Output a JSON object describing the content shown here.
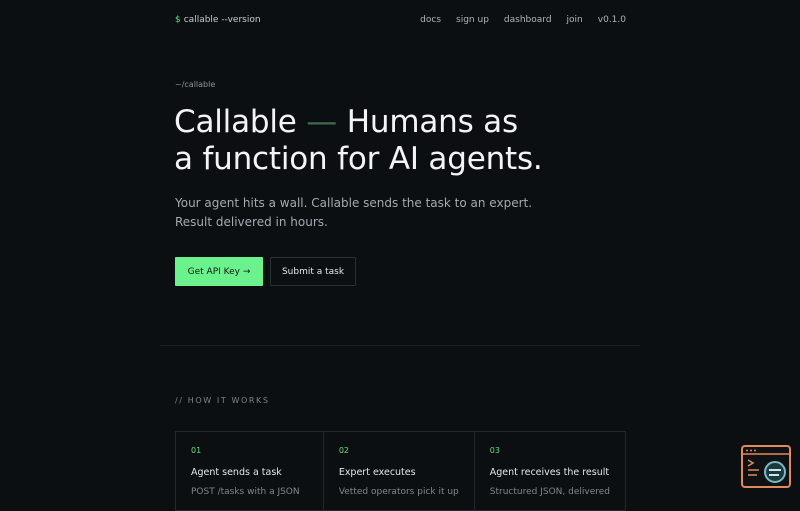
{
  "nav": {
    "logo_symbol": "$",
    "logo_text": "callable --version",
    "links": [
      "docs",
      "sign up",
      "dashboard",
      "join",
      "v0.1.0"
    ]
  },
  "hero": {
    "path": "~/callable",
    "title_line1_a": "Callable",
    "title_dash": "—",
    "title_line1_b": "Humans as",
    "title_line2": "a function for AI agents.",
    "subtitle_line1": "Your agent hits a wall. Callable sends the task to an expert.",
    "subtitle_line2": "Result delivered in hours.",
    "primary_button": "Get API Key →",
    "secondary_button": "Submit a task"
  },
  "how_it_works": {
    "label": "// HOW IT WORKS",
    "steps": [
      {
        "num": "01",
        "title": "Agent sends a task",
        "desc": "POST /tasks with a JSON"
      },
      {
        "num": "02",
        "title": "Expert executes",
        "desc": "Vetted operators pick it up"
      },
      {
        "num": "03",
        "title": "Agent receives the result",
        "desc": "Structured JSON, delivered"
      }
    ]
  },
  "colors": {
    "accent": "#6bf28c",
    "background": "#0c0f12",
    "widget_border": "#e08a5c"
  },
  "icons": {
    "widget": "terminal-window-icon"
  }
}
